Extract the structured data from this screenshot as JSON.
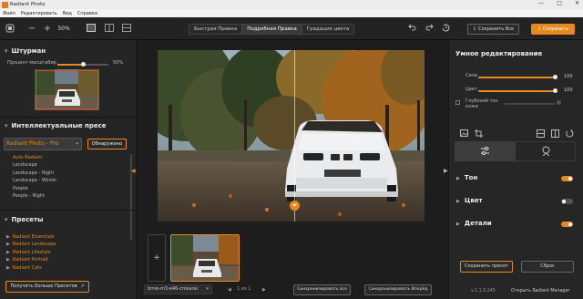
{
  "app": {
    "title": "Radiant Photo"
  },
  "menu": [
    "Файл",
    "Редактировать",
    "Вид",
    "Справка"
  ],
  "window_controls": [
    "—",
    "□",
    "✕"
  ],
  "toolbar": {
    "zoom_percent": "50%",
    "minus": "−",
    "plus": "+",
    "tabs": [
      "Быстрая Правка",
      "Подробная Правка",
      "Градация цвета"
    ],
    "active_tab": 1,
    "save_all": "Сохранить Все",
    "save": "Сохранить"
  },
  "left": {
    "navigator": {
      "title": "Штурман",
      "scale_label": "Процент масштабир",
      "scale_value": "50%",
      "scale_fraction": 0.5
    },
    "smart": {
      "title": "Интеллектуальные пресе",
      "selected": "Radiant Photo - Pro",
      "detect_label": "Обнаружено",
      "items": [
        "Auto Radiant",
        "Landscape",
        "Landscape - Night",
        "Landscape - Winter",
        "People",
        "People - Night"
      ],
      "active_item": 0
    },
    "presets": {
      "title": "Пресеты",
      "items": [
        "Radiant Essentials",
        "Radiant Landscape",
        "Radiant Lifestyle",
        "Radiant Portrait",
        "Radiant Cats"
      ],
      "more_label": "Получить Больше Пресетов"
    }
  },
  "filmstrip": {
    "add_label": "+",
    "filename": "bmw-m3-e46-crosarai",
    "counter": "1 из 1",
    "sync_all": "Синхронизировать все",
    "sync_forward": "Синхронизировать Вперёд"
  },
  "right": {
    "title": "Умное редактирование",
    "sliders": [
      {
        "label": "Сила",
        "value": "100",
        "fraction": 1.0
      },
      {
        "label": "Цвет",
        "value": "100",
        "fraction": 1.0
      }
    ],
    "deep_tone": {
      "label": "Глубокий тон кожи",
      "checked": false
    },
    "sections": [
      {
        "label": "Тон",
        "on": true
      },
      {
        "label": "Цвет",
        "on": false
      },
      {
        "label": "Детали",
        "on": true
      }
    ],
    "save_preset": "Сохранить пресет",
    "reset": "Сброс",
    "version": "v.1.1.0.245",
    "manager": "Открыть Radiant Manager"
  },
  "colors": {
    "accent": "#e8891e"
  }
}
